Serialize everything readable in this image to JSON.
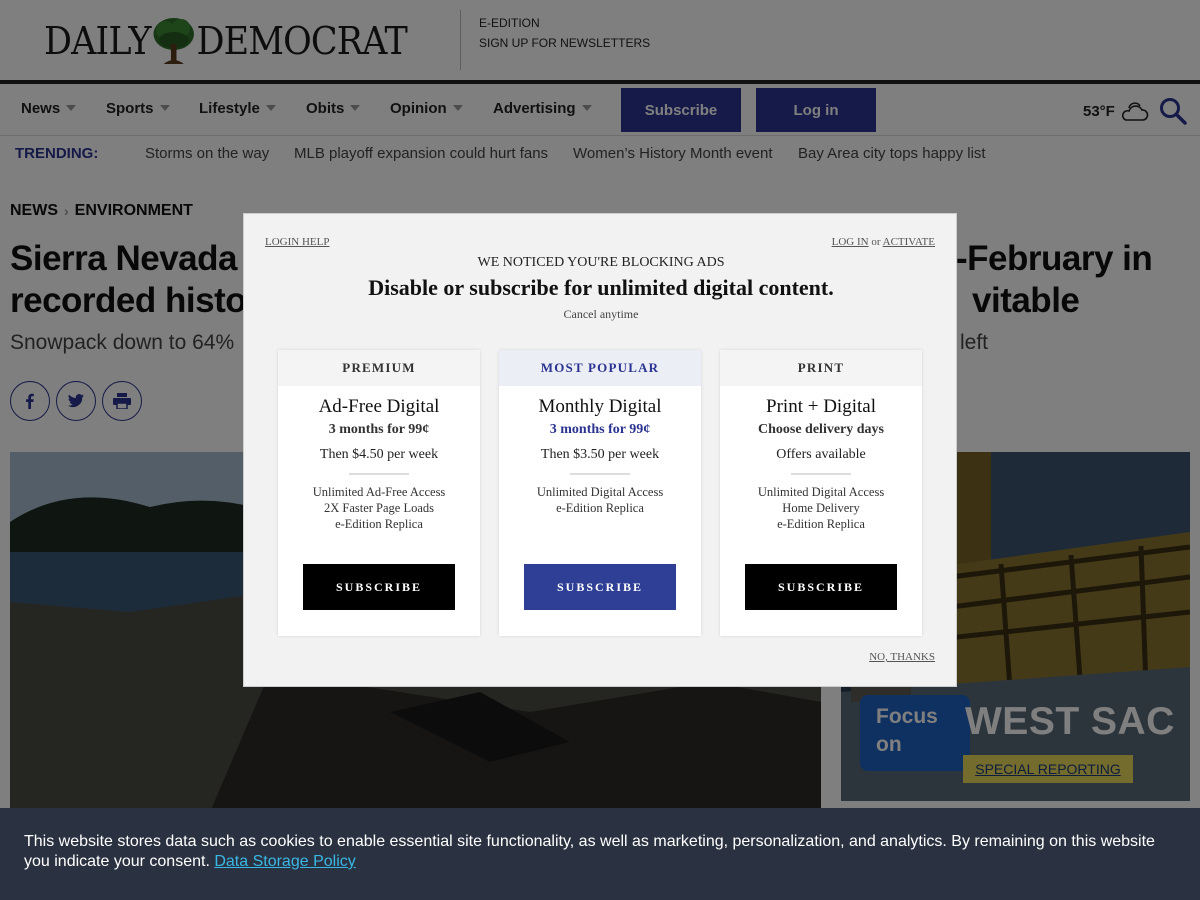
{
  "masthead": {
    "logo_left": "DAILY",
    "logo_right": "DEMOCRAT",
    "links": [
      "E-EDITION",
      "SIGN UP FOR NEWSLETTERS"
    ]
  },
  "nav": {
    "items": [
      "News",
      "Sports",
      "Lifestyle",
      "Obits",
      "Opinion",
      "Advertising"
    ],
    "subscribe": "Subscribe",
    "login": "Log in",
    "weather": "53°F",
    "weather_icon": "partly-cloudy-icon",
    "search_icon": "search-icon"
  },
  "trending": {
    "label": "TRENDING:",
    "items": [
      "Storms on the way",
      "MLB playoff expansion could hurt fans",
      "Women’s History Month event",
      "Bay Area city tops happy list"
    ]
  },
  "article": {
    "breadcrumb": [
      "NEWS",
      "ENVIRONMENT"
    ],
    "headline_left_1": "Sierra Nevada",
    "headline_left_2": "recorded histo",
    "headline_right_1": "-February in",
    "headline_right_2": "vitable",
    "subhead_left": "Snowpack down to 64%",
    "subhead_right": "left"
  },
  "promo": {
    "focus": "Focus\non",
    "west": "WEST SAC",
    "special": "SPECIAL REPORTING"
  },
  "modal": {
    "login_help": "LOGIN HELP",
    "log_in": "LOG IN",
    "or": "or",
    "activate": "ACTIVATE",
    "eyebrow": "WE NOTICED YOU'RE BLOCKING ADS",
    "title": "Disable or subscribe for unlimited digital content.",
    "cancel": "Cancel anytime",
    "plans": [
      {
        "tag": "PREMIUM",
        "name": "Ad-Free Digital",
        "offer": "3 months for 99¢",
        "then": "Then $4.50 per week",
        "features": [
          "Unlimited Ad-Free Access",
          "2X Faster Page Loads",
          "e-Edition Replica"
        ],
        "button": "SUBSCRIBE"
      },
      {
        "tag": "MOST POPULAR",
        "name": "Monthly Digital",
        "offer": "3 months for 99¢",
        "then": "Then $3.50 per week",
        "features": [
          "Unlimited Digital Access",
          "e-Edition Replica"
        ],
        "button": "SUBSCRIBE"
      },
      {
        "tag": "PRINT",
        "name": "Print + Digital",
        "offer": "Choose delivery days",
        "then": "Offers available",
        "features": [
          "Unlimited Digital Access",
          "Home Delivery",
          "e-Edition Replica"
        ],
        "button": "SUBSCRIBE"
      }
    ],
    "no_thanks": "NO, THANKS"
  },
  "cookie": {
    "text": "This website stores data such as cookies to enable essential site functionality, as well as marketing, personalization, and analytics. By remaining on this website you indicate your consent.",
    "link": "Data Storage Policy"
  },
  "colors": {
    "brand_blue": "#2b3491",
    "cookie_bg": "#2a3140",
    "cookie_link": "#39b8e6"
  }
}
